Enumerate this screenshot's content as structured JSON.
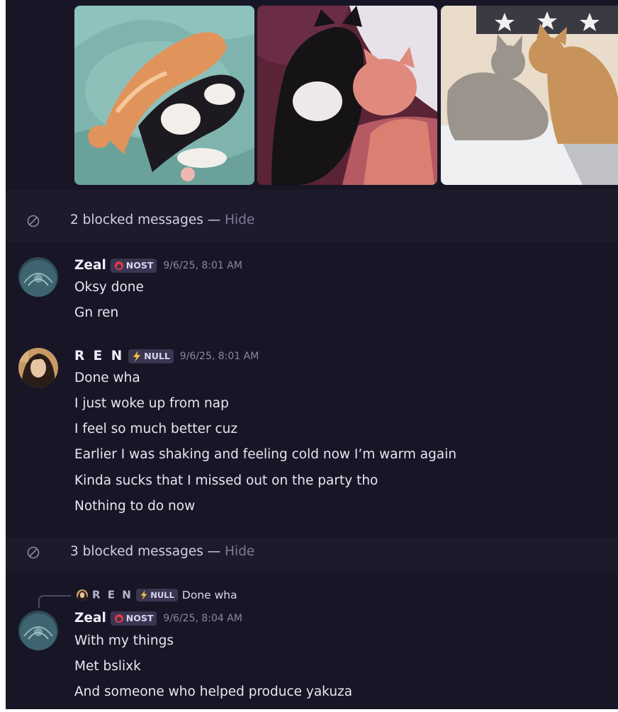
{
  "gallery": {
    "images": [
      {
        "label": "Orange and black-white kittens sleeping curled together on a teal blanket"
      },
      {
        "label": "Black-white cat and orange cat cuddling on a pink blanket"
      },
      {
        "label": "Grey tabby cat and orange cat touching noses on a bed"
      }
    ]
  },
  "blocked": [
    {
      "count_text": "2 blocked messages",
      "separator": " — ",
      "hide_label": "Hide"
    },
    {
      "count_text": "3 blocked messages",
      "separator": " — ",
      "hide_label": "Hide"
    }
  ],
  "messages": [
    {
      "author": "Zeal",
      "tag": "NOST",
      "timestamp": "9/6/25, 8:01 AM",
      "lines": [
        "Oksy done",
        "Gn ren"
      ]
    },
    {
      "author": "R E N",
      "tag": "NULL",
      "timestamp": "9/6/25, 8:01 AM",
      "lines": [
        "Done wha",
        "I just woke up from nap",
        "I feel so much better cuz",
        "Earlier I was shaking and feeling cold now I’m warm again",
        "Kinda sucks that I missed out on the party tho",
        "Nothing to do now"
      ]
    },
    {
      "reply_to": {
        "author": "R E N",
        "tag": "NULL",
        "text": "Done wha"
      },
      "author": "Zeal",
      "tag": "NOST",
      "timestamp": "9/6/25, 8:04 AM",
      "lines": [
        "With my things",
        "Met bslixk",
        "And someone who helped produce yakuza"
      ]
    }
  ],
  "icons": {
    "blocked": "blocked-circle-icon",
    "nost_tag": "red-ring-icon",
    "null_tag": "lightning-icon"
  },
  "colors": {
    "background": "#181626",
    "blocked_band": "#1d1a2b",
    "tag_bg": "#3a3551",
    "timestamp": "#8b879f",
    "hide_link": "#7e7a96",
    "nost_icon": "#e23a44",
    "null_icon": "#f5c33b"
  }
}
